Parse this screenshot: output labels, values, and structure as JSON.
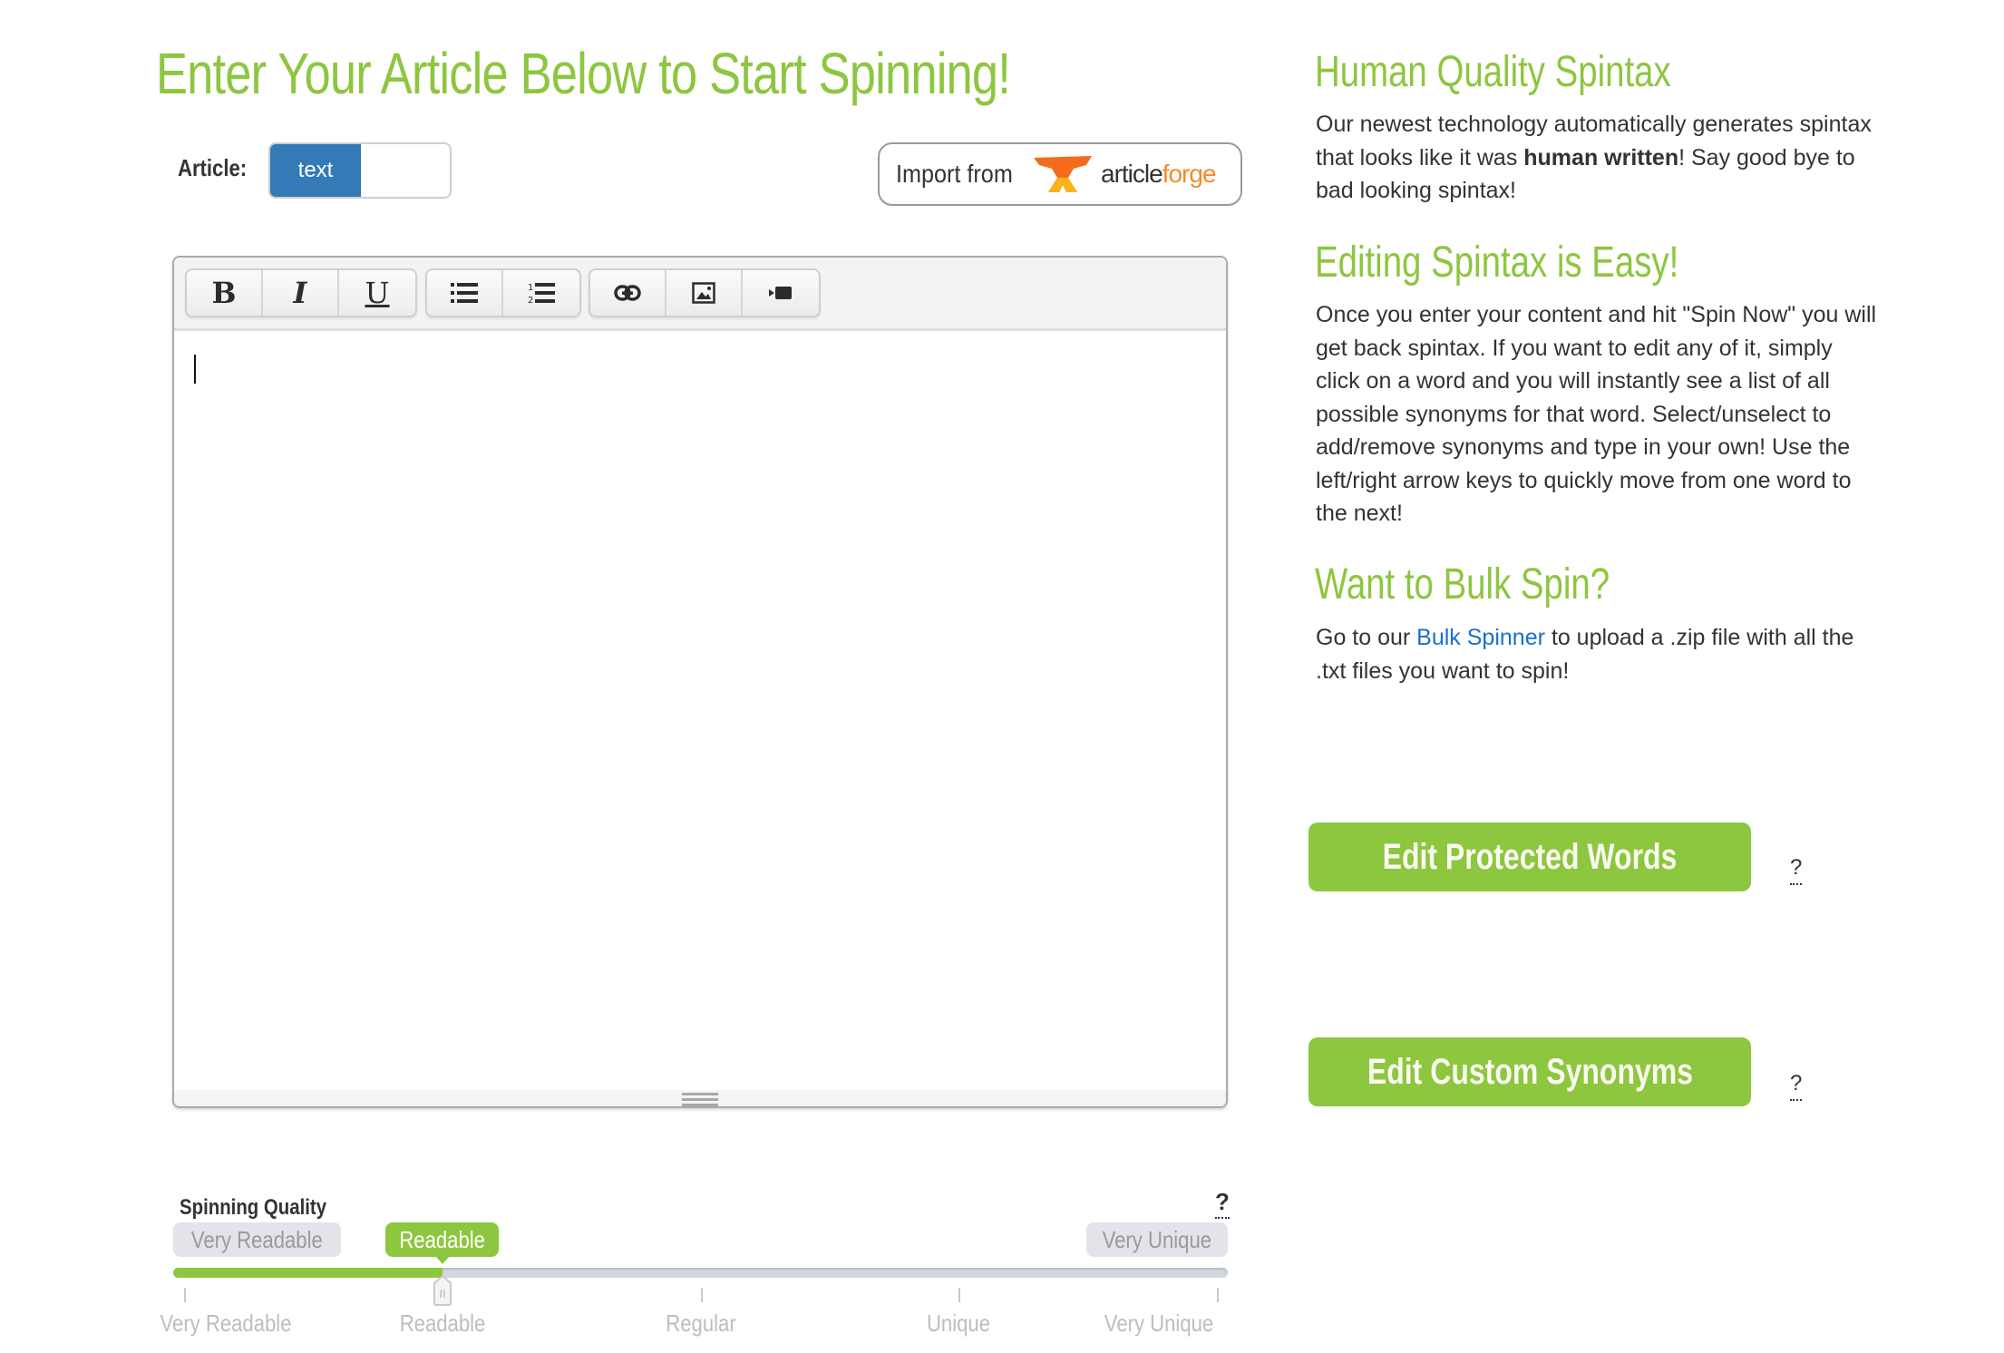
{
  "main": {
    "title": "Enter Your Article Below to Start Spinning!",
    "article_label": "Article:",
    "article_toggle": {
      "active_option": "text"
    },
    "import_button": {
      "label": "Import from",
      "brand_part1": "article",
      "brand_part2": "forge"
    },
    "editor": {
      "toolbar": [
        {
          "name": "bold",
          "glyph": "B"
        },
        {
          "name": "italic",
          "glyph": "I"
        },
        {
          "name": "underline",
          "glyph": "U"
        },
        {
          "name": "bullet-list",
          "glyph": ""
        },
        {
          "name": "numbered-list",
          "glyph": ""
        },
        {
          "name": "link",
          "glyph": ""
        },
        {
          "name": "image",
          "glyph": ""
        },
        {
          "name": "video",
          "glyph": ""
        }
      ],
      "content": ""
    }
  },
  "quality": {
    "title": "Spinning Quality",
    "help": "?",
    "min_label": "Very Readable",
    "max_label": "Very Unique",
    "current_label": "Readable",
    "current_index": 1,
    "levels": [
      "Very Readable",
      "Readable",
      "Regular",
      "Unique",
      "Very Unique"
    ]
  },
  "sidebar": {
    "sections": [
      {
        "heading": "Human Quality Spintax",
        "text_before": "Our newest technology automatically generates spintax that looks like it was ",
        "bold": "human written",
        "text_after": "! Say good bye to bad looking spintax!"
      },
      {
        "heading": "Editing Spintax is Easy!",
        "text": "Once you enter your content and hit \"Spin Now\" you will get back spintax. If you want to edit any of it, simply click on a word and you will instantly see a list of all possible synonyms for that word. Select/unselect to add/remove synonyms and type in your own! Use the left/right arrow keys to quickly move from one word to the next!"
      },
      {
        "heading": "Want to Bulk Spin?",
        "text_before": "Go to our ",
        "link": "Bulk Spinner",
        "text_after": " to upload a .zip file with all the .txt files you want to spin!"
      }
    ],
    "buttons": [
      {
        "label": "Edit Protected Words",
        "help": "?"
      },
      {
        "label": "Edit Custom Synonyms",
        "help": "?"
      }
    ]
  },
  "colors": {
    "accent_green": "#8dc63f",
    "toggle_blue": "#337ab7",
    "link_blue": "#1a6fce",
    "brand_orange": "#f58a2b"
  }
}
